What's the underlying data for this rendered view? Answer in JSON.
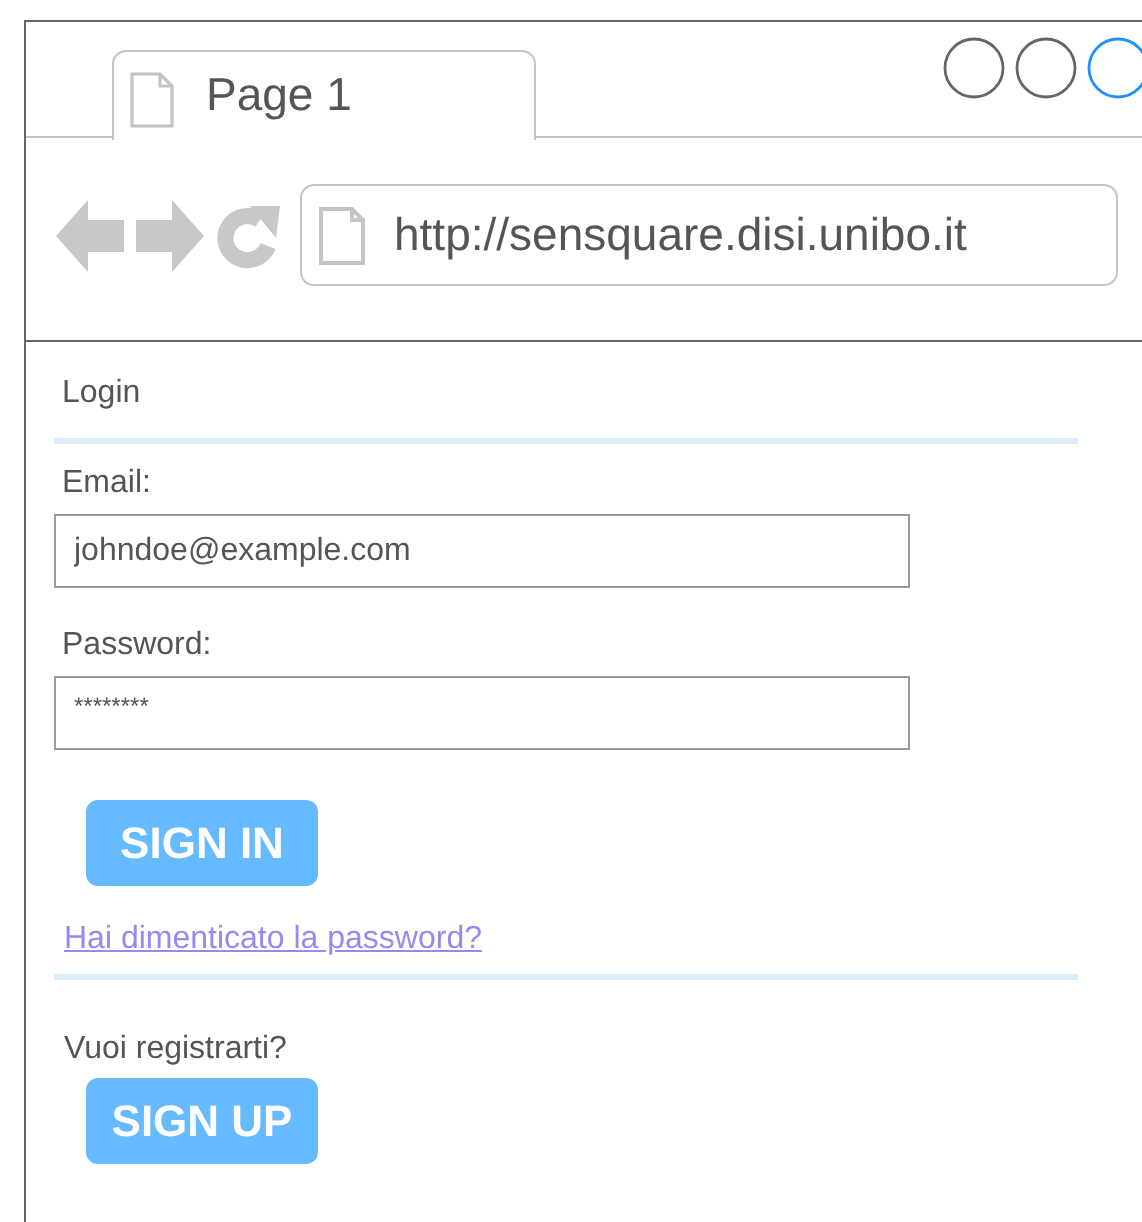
{
  "browser": {
    "tab": {
      "title": "Page 1",
      "selected": true
    },
    "url": "http://sensquare.disi.unibo.it"
  },
  "login": {
    "heading": "Login",
    "fields": [
      {
        "label": "Email:",
        "value": "johndoe@example.com",
        "kind": "text"
      },
      {
        "label": "Password:",
        "value": "********",
        "kind": "password"
      }
    ],
    "submit": "SIGN IN",
    "forgot_link": "Hai dimenticato la password?",
    "register_prompt": "Vuoi registrarti?",
    "register_button": "SIGN UP"
  }
}
